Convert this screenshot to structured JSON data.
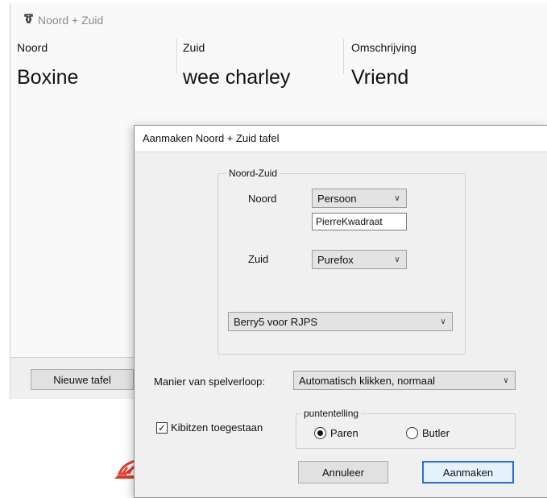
{
  "background_window": {
    "title": "Noord + Zuid",
    "columns": [
      {
        "header": "Noord",
        "value": "Boxine"
      },
      {
        "header": "Zuid",
        "value": "wee charley"
      },
      {
        "header": "Omschrijving",
        "value": "Vriend"
      }
    ],
    "new_table_button": "Nieuwe tafel"
  },
  "dialog": {
    "title": "Aanmaken Noord + Zuid tafel",
    "group_noord_zuid": {
      "legend": "Noord-Zuid",
      "noord_label": "Noord",
      "noord_type": "Persoon",
      "noord_name": "PierreKwadraat",
      "zuid_label": "Zuid",
      "zuid_value": "Purefox",
      "program": "Berry5 voor RJPS"
    },
    "gameplay_label": "Manier van spelverloop:",
    "gameplay_value": "Automatisch klikken, normaal",
    "kibitz_label": "Kibitzen toegestaan",
    "kibitz_checked": true,
    "scoring": {
      "legend": "puntentelling",
      "option_pairs": "Paren",
      "option_butler": "Butler",
      "selected": "Paren"
    },
    "cancel_button": "Annuleer",
    "create_button": "Aanmaken"
  },
  "colors": {
    "accent": "#2a6fd0",
    "logo": "#e03a2a"
  }
}
